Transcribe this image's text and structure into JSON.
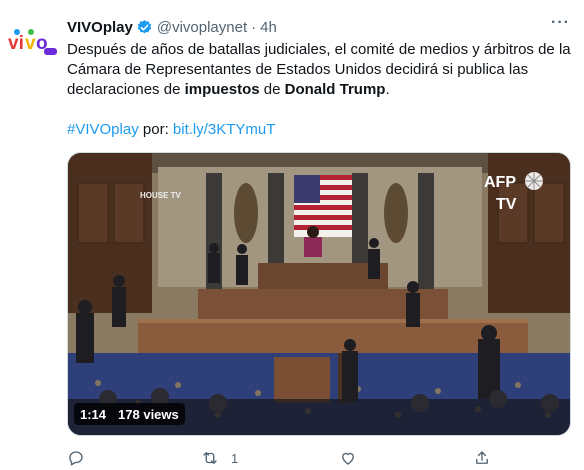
{
  "tweet": {
    "author_name": "VIVOplay",
    "handle": "@vivoplaynet",
    "separator": "·",
    "time": "4h",
    "more": "···",
    "text_part1": "Después de años de batallas judiciales, el comité de medios y árbitros de la Cámara de Representantes de Estados Unidos decidirá si publica las declaraciones de ",
    "text_bold1": "impuestos",
    "text_part2": " de ",
    "text_bold2": "Donald Trump",
    "text_end": ".",
    "hashtag": "#VIVOplay",
    "por": " por: ",
    "link": "bit.ly/3KTYmuT"
  },
  "media": {
    "duration": "1:14",
    "views": "178 views",
    "channel_label": "HOUSE TV",
    "afp_text": "AFP",
    "tv_text": "TV"
  },
  "actions": {
    "retweet_count": "1"
  },
  "colors": {
    "accent": "#1d9bf0",
    "secondary_text": "#536471",
    "logo_red": "#e53935",
    "logo_purple": "#6b2bd9"
  }
}
